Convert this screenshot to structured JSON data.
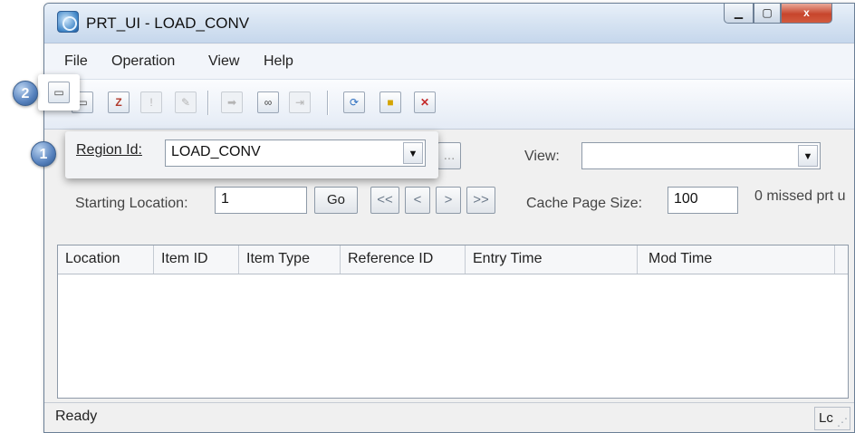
{
  "window": {
    "title": "PRT_UI - LOAD_CONV",
    "close_glyph": "x"
  },
  "menu": [
    "File",
    "Operation",
    "View",
    "Help"
  ],
  "toolbar_icons": [
    "new-window-icon",
    "calendar-icon",
    "alert-icon",
    "key-icon",
    "arrow-right-icon",
    "binoculars-icon",
    "find-next-icon",
    "refresh-icon",
    "lock-icon",
    "delete-icon"
  ],
  "form": {
    "region_label": "Region Id:",
    "region_value": "LOAD_CONV",
    "browse_label": "...",
    "view_label": "View:",
    "view_value": "",
    "starting_location_label": "Starting Location:",
    "starting_location_value": "1",
    "go_label": "Go",
    "nav": [
      "<<",
      "<",
      ">",
      ">>"
    ],
    "cache_page_size_label": "Cache Page Size:",
    "cache_page_size_value": "100",
    "missed_text": "0 missed prt u"
  },
  "grid": {
    "columns": [
      "Location",
      "Item ID",
      "Item Type",
      "Reference ID",
      "Entry Time",
      "Mod Time"
    ]
  },
  "status": {
    "text": "Ready",
    "pane": "Lc"
  },
  "callouts": [
    "1",
    "2"
  ]
}
